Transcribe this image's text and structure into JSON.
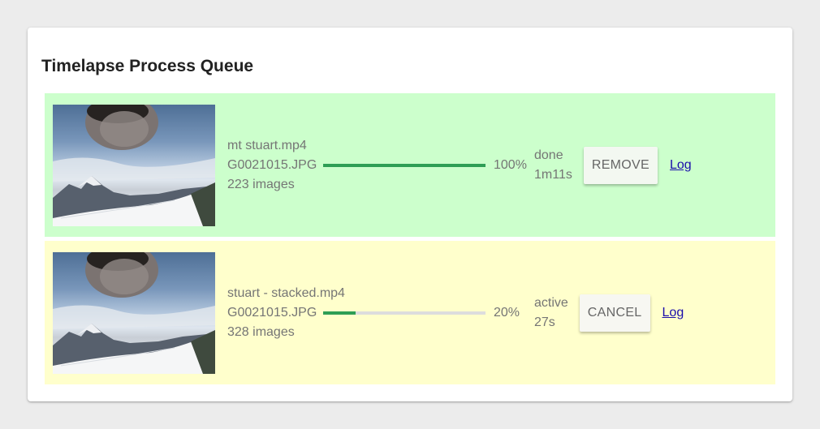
{
  "page": {
    "title": "Timelapse Process Queue"
  },
  "jobs": [
    {
      "status": "done",
      "output_file": "mt stuart.mp4",
      "source_file": "G0021015.JPG",
      "image_count": "223 images",
      "progress": 1.0,
      "progress_label": "100%",
      "state": "done",
      "elapsed": "1m11s",
      "action_label": "REMOVE",
      "log_label": "Log",
      "row_color": "#ccffcc"
    },
    {
      "status": "active",
      "output_file": "stuart - stacked.mp4",
      "source_file": "G0021015.JPG",
      "image_count": "328 images",
      "progress": 0.2,
      "progress_label": "20%",
      "state": "active",
      "elapsed": "27s",
      "action_label": "CANCEL",
      "log_label": "Log",
      "row_color": "#ffffcc"
    }
  ],
  "colors": {
    "progress_fill": "#2e9e55",
    "progress_track": "#dddddd",
    "link": "#1a0dab"
  }
}
